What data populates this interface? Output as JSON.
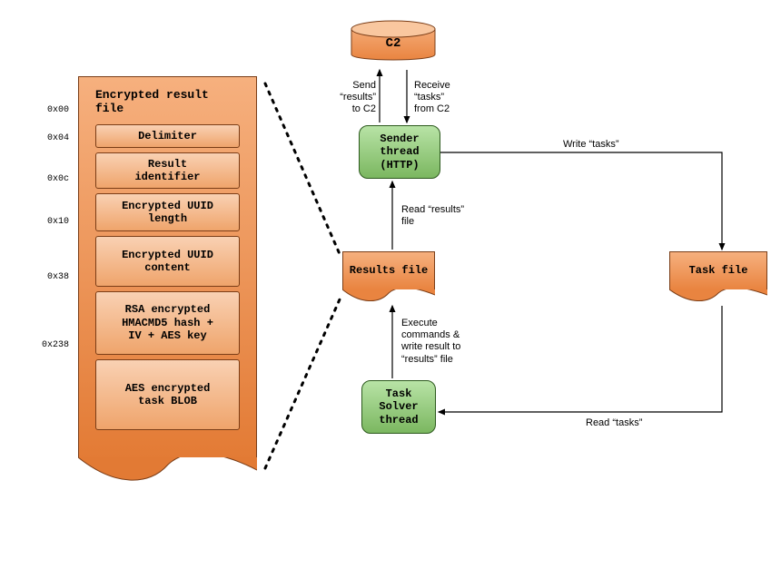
{
  "c2": {
    "label": "C2"
  },
  "labels": {
    "send_to_c2": "Send\n“results”\nto C2",
    "receive_from_c2": "Receive\n“tasks”\nfrom C2",
    "write_tasks": "Write “tasks”",
    "read_results": "Read “results”\nfile",
    "exec_write": "Execute\ncommands &\nwrite result to\n“results” file",
    "read_tasks": "Read “tasks”"
  },
  "sender_thread": {
    "label": "Sender\nthread\n(HTTP)"
  },
  "task_solver": {
    "label": "Task\nSolver\nthread"
  },
  "results_file": {
    "label": "Results\nfile"
  },
  "task_file": {
    "label": "Task file"
  },
  "encrypted_file": {
    "title": "Encrypted result file",
    "offsets": [
      "0x00",
      "0x04",
      "0x0c",
      "0x10",
      "0x38",
      "0x238"
    ],
    "rows": [
      "Delimiter",
      "Result\nidentifier",
      "Encrypted UUID\nlength",
      "Encrypted UUID\ncontent",
      "RSA encrypted\nHMACMD5 hash +\nIV + AES key",
      "AES encrypted\ntask BLOB"
    ]
  }
}
